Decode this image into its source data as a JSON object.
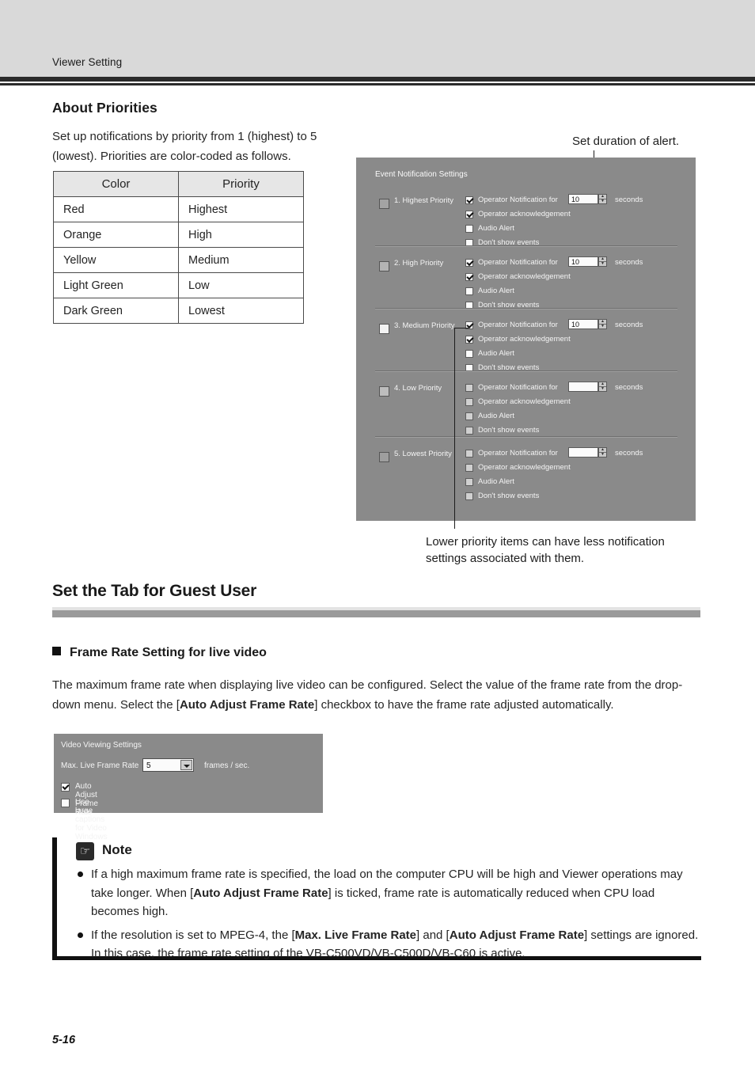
{
  "page": {
    "running_head": "Viewer Setting",
    "folio": "5-16"
  },
  "about": {
    "heading": "About Priorities",
    "paragraph": "Set up notifications by priority from 1 (highest) to 5 (lowest). Priorities are color-coded as follows.",
    "table": {
      "headers": [
        "Color",
        "Priority"
      ],
      "rows": [
        [
          "Red",
          "Highest"
        ],
        [
          "Orange",
          "High"
        ],
        [
          "Yellow",
          "Medium"
        ],
        [
          "Light Green",
          "Low"
        ],
        [
          "Dark Green",
          "Lowest"
        ]
      ]
    }
  },
  "callouts": {
    "top": "Set duration of alert.",
    "bottom": "Lower priority items can have less notification settings associated with them."
  },
  "event_dialog": {
    "title": "Event Notification Settings",
    "seconds_label": "seconds",
    "spinner_up": "▲",
    "spinner_down": "▼",
    "groups": [
      {
        "name": "1. Highest Priority",
        "swatch_color": "#a3a3a3",
        "duration": "10",
        "options": [
          {
            "label": "Operator Notification  for",
            "checked": true
          },
          {
            "label": "Operator acknowledgement",
            "checked": true
          },
          {
            "label": "Audio Alert",
            "checked": false
          },
          {
            "label": "Don't show events",
            "checked": false
          }
        ]
      },
      {
        "name": "2. High Priority",
        "swatch_color": "#b4b4b4",
        "duration": "10",
        "options": [
          {
            "label": "Operator Notification  for",
            "checked": true
          },
          {
            "label": "Operator acknowledgement",
            "checked": true
          },
          {
            "label": "Audio Alert",
            "checked": false
          },
          {
            "label": "Don't show events",
            "checked": false
          }
        ]
      },
      {
        "name": "3. Medium Priority",
        "swatch_color": "#f2f2f2",
        "duration": "10",
        "options": [
          {
            "label": "Operator Notification  for",
            "checked": true
          },
          {
            "label": "Operator acknowledgement",
            "checked": true
          },
          {
            "label": "Audio Alert",
            "checked": false
          },
          {
            "label": "Don't show events",
            "checked": false
          }
        ]
      },
      {
        "name": "4. Low Priority",
        "swatch_color": "#bdbdbd",
        "duration": "",
        "options": [
          {
            "label": "Operator Notification  for",
            "checked": false
          },
          {
            "label": "Operator acknowledgement",
            "checked": false
          },
          {
            "label": "Audio Alert",
            "checked": false
          },
          {
            "label": "Don't show events",
            "checked": false
          }
        ]
      },
      {
        "name": "5. Lowest Priority",
        "swatch_color": "#9e9e9e",
        "duration": "",
        "options": [
          {
            "label": "Operator Notification  for",
            "checked": false
          },
          {
            "label": "Operator acknowledgement",
            "checked": false
          },
          {
            "label": "Audio Alert",
            "checked": false
          },
          {
            "label": "Don't show events",
            "checked": false
          }
        ]
      }
    ]
  },
  "section": {
    "heading": "Set the Tab for Guest User",
    "sub_heading": "Frame Rate Setting for live video",
    "paragraph_parts": [
      {
        "text": "The maximum frame rate when displaying live video can be configured. Select the value of the frame rate from the drop-down menu. Select the [",
        "bold": false
      },
      {
        "text": "Auto Adjust Frame Rate",
        "bold": true
      },
      {
        "text": "] checkbox to have the frame rate adjusted automatically.",
        "bold": false
      }
    ]
  },
  "video_dialog": {
    "title": "Video Viewing Settings",
    "frame_rate_label": "Max. Live Frame Rate",
    "frame_rate_value": "5",
    "frame_rate_units": "frames / sec.",
    "dropdown_icon": "chevron-down-icon",
    "checkboxes": [
      {
        "label": "Auto Adjust Frame Rate",
        "checked": true
      },
      {
        "label": "Use large captions for Video Windows",
        "checked": false
      }
    ]
  },
  "note": {
    "icon": "pointing-hand-icon",
    "icon_glyph": "☞",
    "title": "Note",
    "items": [
      [
        {
          "text": "If a high maximum frame rate is specified, the load on the computer CPU will be high and Viewer operations may take longer. When [",
          "bold": false
        },
        {
          "text": "Auto Adjust Frame Rate",
          "bold": true
        },
        {
          "text": "] is ticked, frame rate is automatically reduced when CPU load becomes high.",
          "bold": false
        }
      ],
      [
        {
          "text": "If the resolution is set to MPEG-4, the [",
          "bold": false
        },
        {
          "text": "Max. Live Frame Rate",
          "bold": true
        },
        {
          "text": "] and [",
          "bold": false
        },
        {
          "text": "Auto Adjust Frame Rate",
          "bold": true
        },
        {
          "text": "] settings are ignored. In this case, the frame rate setting of the VB-C500VD/VB-C500D/VB-C60 is active.",
          "bold": false
        }
      ]
    ]
  }
}
